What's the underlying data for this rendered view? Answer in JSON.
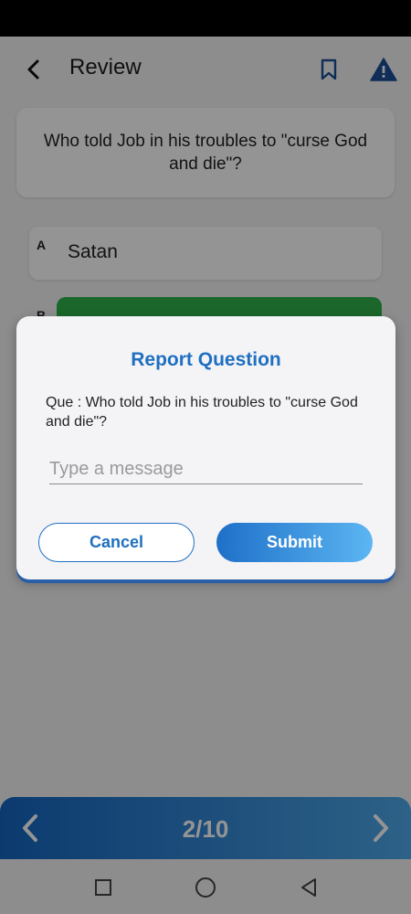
{
  "header": {
    "title": "Review"
  },
  "question": {
    "text": "Who told Job in his troubles to \"curse God and die\"?"
  },
  "options": [
    {
      "letter": "A",
      "text": "Satan"
    },
    {
      "letter": "B",
      "text": ""
    }
  ],
  "footer": {
    "counter": "2/10"
  },
  "dialog": {
    "title": "Report Question",
    "question_text": "Que : Who told Job in his troubles to \"curse God and die\"?",
    "input_placeholder": "Type a message",
    "input_value": "",
    "cancel_label": "Cancel",
    "submit_label": "Submit"
  },
  "colors": {
    "accent": "#1f6fc0",
    "correct": "#2fb24a",
    "overlay": "rgba(0,0,0,0.42)"
  },
  "icons": {
    "back": "chevron-left-icon",
    "bookmark": "bookmark-icon",
    "report": "warning-icon",
    "prev": "chevron-left-icon",
    "next": "chevron-right-icon"
  }
}
